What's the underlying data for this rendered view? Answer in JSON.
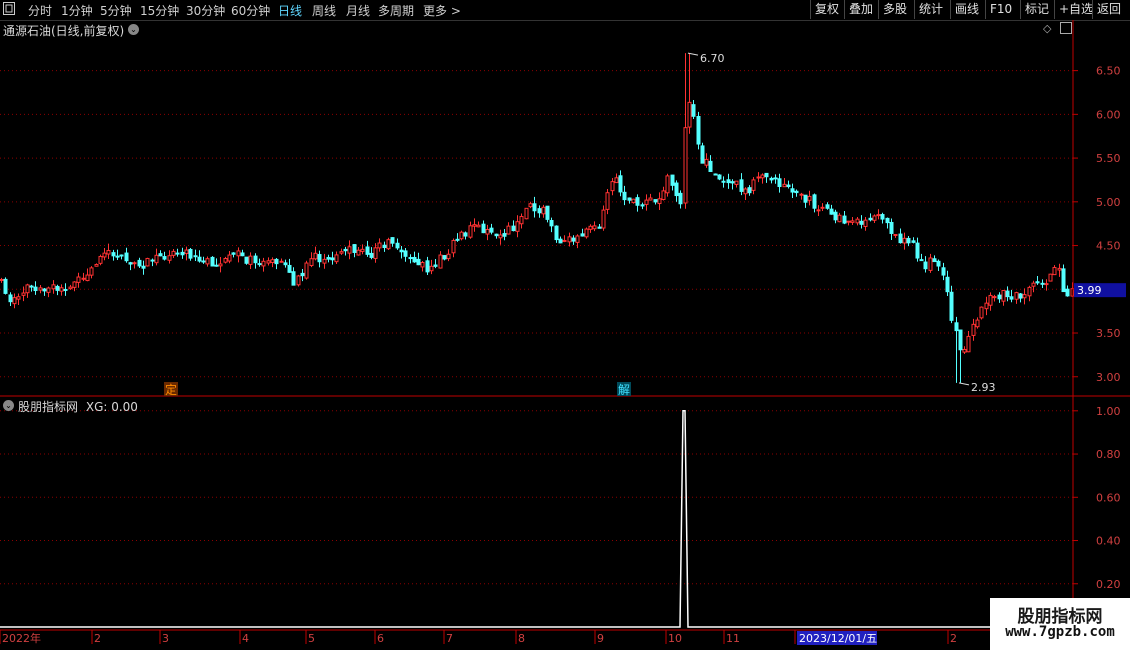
{
  "toolbar": {
    "menu_icon": "menu-box-icon",
    "periods": [
      "分时",
      "1分钟",
      "5分钟",
      "15分钟",
      "30分钟",
      "60分钟",
      "日线",
      "周线",
      "月线",
      "多周期",
      "更多 >"
    ],
    "active_period": "日线",
    "buttons": [
      "复权",
      "叠加",
      "多股",
      "统计",
      "画线",
      "F10",
      "标记",
      "+自选",
      "返回"
    ]
  },
  "main_panel": {
    "title": "通源石油(日线,前复权)",
    "high_label": "6.70",
    "low_label": "2.93",
    "last_price": "3.99",
    "marker_ding": "定",
    "marker_jie": "解"
  },
  "indicator_panel": {
    "title": "股朋指标网",
    "value_label": "XG: 0.00"
  },
  "x_axis": {
    "labels": [
      "2022年",
      "2",
      "3",
      "4",
      "5",
      "6",
      "7",
      "8",
      "9",
      "10",
      "11",
      "2023/12/01/五",
      "2"
    ]
  },
  "watermark": {
    "line1": "股朋指标网",
    "line2": "www.7gpzb.com"
  },
  "colors": {
    "up": "#ff3232",
    "down": "#54ffff",
    "grid": "#8b0000",
    "axis": "#c00000",
    "signal": "#ffffff"
  },
  "chart_data": [
    {
      "type": "candlestick",
      "title": "通源石油(日线,前复权)",
      "y_ticks": [
        3.0,
        3.5,
        4.0,
        4.5,
        5.0,
        5.5,
        6.0,
        6.5
      ],
      "ylim": [
        2.78,
        6.85
      ],
      "max_high": 6.7,
      "min_low": 2.93,
      "last": 3.99,
      "close_profile": [
        [
          0,
          4.1
        ],
        [
          10,
          3.9
        ],
        [
          25,
          4.0
        ],
        [
          40,
          4.05
        ],
        [
          60,
          4.0
        ],
        [
          75,
          4.08
        ],
        [
          90,
          4.25
        ],
        [
          110,
          4.4
        ],
        [
          125,
          4.35
        ],
        [
          140,
          4.28
        ],
        [
          160,
          4.35
        ],
        [
          180,
          4.4
        ],
        [
          200,
          4.38
        ],
        [
          220,
          4.28
        ],
        [
          240,
          4.4
        ],
        [
          260,
          4.25
        ],
        [
          280,
          4.35
        ],
        [
          295,
          4.05
        ],
        [
          310,
          4.4
        ],
        [
          330,
          4.3
        ],
        [
          350,
          4.48
        ],
        [
          370,
          4.4
        ],
        [
          390,
          4.55
        ],
        [
          410,
          4.35
        ],
        [
          430,
          4.22
        ],
        [
          445,
          4.4
        ],
        [
          460,
          4.65
        ],
        [
          480,
          4.7
        ],
        [
          500,
          4.62
        ],
        [
          515,
          4.75
        ],
        [
          530,
          4.95
        ],
        [
          545,
          4.9
        ],
        [
          555,
          4.6
        ],
        [
          570,
          4.55
        ],
        [
          585,
          4.65
        ],
        [
          600,
          4.75
        ],
        [
          612,
          5.3
        ],
        [
          625,
          5.05
        ],
        [
          640,
          4.95
        ],
        [
          655,
          5.0
        ],
        [
          668,
          5.25
        ],
        [
          680,
          4.95
        ],
        [
          685,
          5.9
        ],
        [
          690,
          6.2
        ],
        [
          700,
          5.5
        ],
        [
          715,
          5.35
        ],
        [
          730,
          5.2
        ],
        [
          750,
          5.15
        ],
        [
          765,
          5.35
        ],
        [
          780,
          5.15
        ],
        [
          800,
          5.1
        ],
        [
          815,
          4.95
        ],
        [
          830,
          4.85
        ],
        [
          850,
          4.8
        ],
        [
          865,
          4.75
        ],
        [
          880,
          4.82
        ],
        [
          895,
          4.6
        ],
        [
          910,
          4.55
        ],
        [
          925,
          4.25
        ],
        [
          935,
          4.35
        ],
        [
          945,
          4.05
        ],
        [
          955,
          3.5
        ],
        [
          962,
          3.15
        ],
        [
          970,
          3.55
        ],
        [
          985,
          3.85
        ],
        [
          1000,
          3.95
        ],
        [
          1015,
          3.9
        ],
        [
          1030,
          4.0
        ],
        [
          1045,
          4.1
        ],
        [
          1058,
          4.25
        ],
        [
          1065,
          3.95
        ],
        [
          1072,
          3.99
        ]
      ]
    },
    {
      "type": "line",
      "title": "股朋指标网",
      "series": [
        {
          "name": "XG",
          "signal_x": 684,
          "signal_value": 1.0,
          "baseline": 0.0
        }
      ],
      "y_ticks": [
        0.2,
        0.4,
        0.6,
        0.8,
        1.0
      ],
      "ylim": [
        0.0,
        1.05
      ]
    }
  ]
}
